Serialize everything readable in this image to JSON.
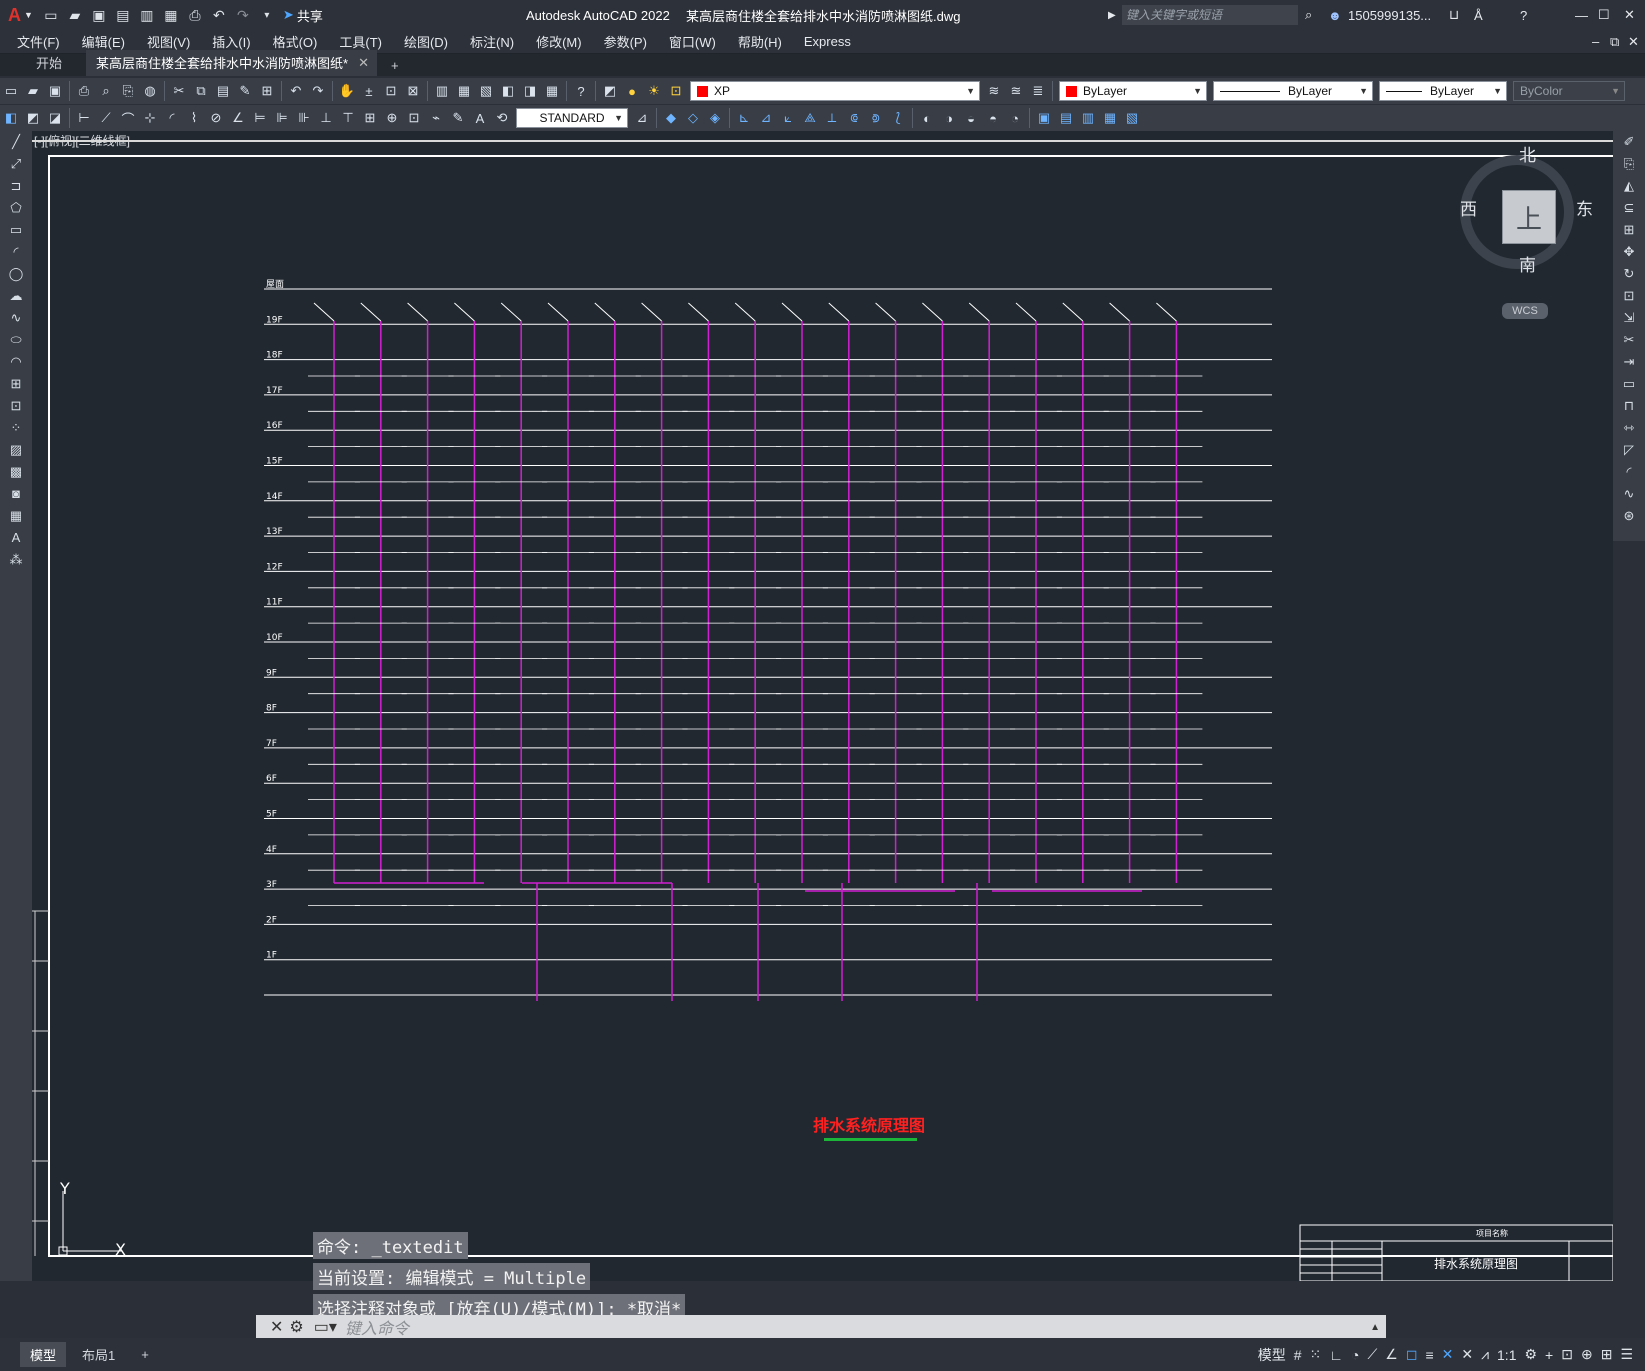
{
  "app": {
    "title": "Autodesk AutoCAD 2022",
    "filename": "某高层商住楼全套给排水中水消防喷淋图纸.dwg",
    "share_label": "共享",
    "search_placeholder": "键入关键字或短语",
    "user": "1505999135...",
    "logo": "A"
  },
  "menu": [
    "文件(F)",
    "编辑(E)",
    "视图(V)",
    "插入(I)",
    "格式(O)",
    "工具(T)",
    "绘图(D)",
    "标注(N)",
    "修改(M)",
    "参数(P)",
    "窗口(W)",
    "帮助(H)",
    "Express"
  ],
  "tabs": [
    {
      "label": "开始",
      "active": false
    },
    {
      "label": "某高层商住楼全套给排水中水消防喷淋图纸*",
      "active": true
    }
  ],
  "toolbar": {
    "layer": "XP",
    "color": "ByLayer",
    "linetype": "ByLayer",
    "lineweight": "ByLayer",
    "plotstyle": "ByColor",
    "textstyle": "STANDARD",
    "layer_color": "#ff0000"
  },
  "viewport": {
    "label": "[-][俯视][二维线框]",
    "compass": {
      "north": "北",
      "south": "南",
      "east": "东",
      "west": "西",
      "top": "上"
    },
    "wcs": "WCS",
    "ucs_y": "Y",
    "ucs_x": "X"
  },
  "drawing": {
    "title": "排水系统原理图",
    "floors": [
      "屋面",
      "19F",
      "18F",
      "17F",
      "16F",
      "15F",
      "14F",
      "13F",
      "12F",
      "11F",
      "10F",
      "9F",
      "8F",
      "7F",
      "6F",
      "5F",
      "4F",
      "3F",
      "2F",
      "1F"
    ],
    "titleblock_title": "排水系统原理图",
    "titleblock_header": "项目名称"
  },
  "command": {
    "history": [
      "命令: _textedit",
      "当前设置: 编辑模式 = Multiple",
      "选择注释对象或 [放弃(U)/模式(M)]: *取消*"
    ],
    "placeholder": "键入命令"
  },
  "status": {
    "layout_tabs": [
      "模型",
      "布局1"
    ],
    "model_label": "模型",
    "scale": "1:1"
  }
}
